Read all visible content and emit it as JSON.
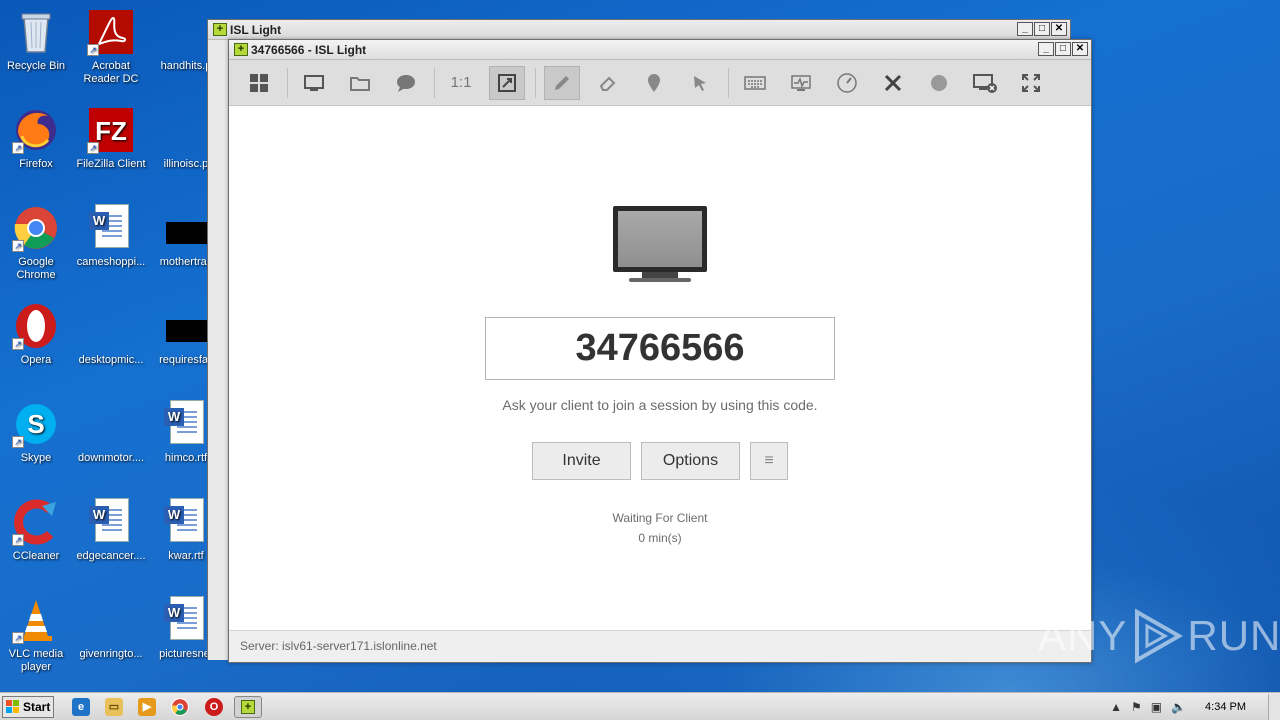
{
  "desktop": {
    "icons": [
      {
        "label": "Recycle Bin"
      },
      {
        "label": "Acrobat Reader DC"
      },
      {
        "label": "handhits.p"
      },
      {
        "label": "Firefox"
      },
      {
        "label": "FileZilla Client"
      },
      {
        "label": "illinoisc.p"
      },
      {
        "label": "Google Chrome"
      },
      {
        "label": "cameshoppi..."
      },
      {
        "label": "mothertrac"
      },
      {
        "label": "Opera"
      },
      {
        "label": "desktopmic..."
      },
      {
        "label": "requiresfall"
      },
      {
        "label": "Skype"
      },
      {
        "label": "downmotor...."
      },
      {
        "label": "himco.rtf"
      },
      {
        "label": "CCleaner"
      },
      {
        "label": "edgecancer...."
      },
      {
        "label": "kwar.rtf"
      },
      {
        "label": "VLC media player"
      },
      {
        "label": "givenringto..."
      },
      {
        "label": "picturesnet"
      }
    ]
  },
  "back_window": {
    "title": "ISL Light"
  },
  "main_window": {
    "title": "34766566 - ISL Light",
    "toolbar": {
      "one_to_one_label": "1:1"
    },
    "session_code": "34766566",
    "hint": "Ask your client to join a session by using this code.",
    "invite_label": "Invite",
    "options_label": "Options",
    "menu_label": "≡",
    "status_label": "Waiting For Client",
    "status_time": "0 min(s)",
    "server": "Server: islv61-server171.islonline.net"
  },
  "window_buttons": {
    "minimize": "_",
    "maximize": "□",
    "close": "✕"
  },
  "watermark": {
    "left": "ANY",
    "right": "RUN"
  },
  "taskbar": {
    "start_label": "Start",
    "clock": "4:34 PM"
  },
  "colors": {
    "desktop_blue": "#1570d0",
    "accent_green": "#b6d83a"
  }
}
